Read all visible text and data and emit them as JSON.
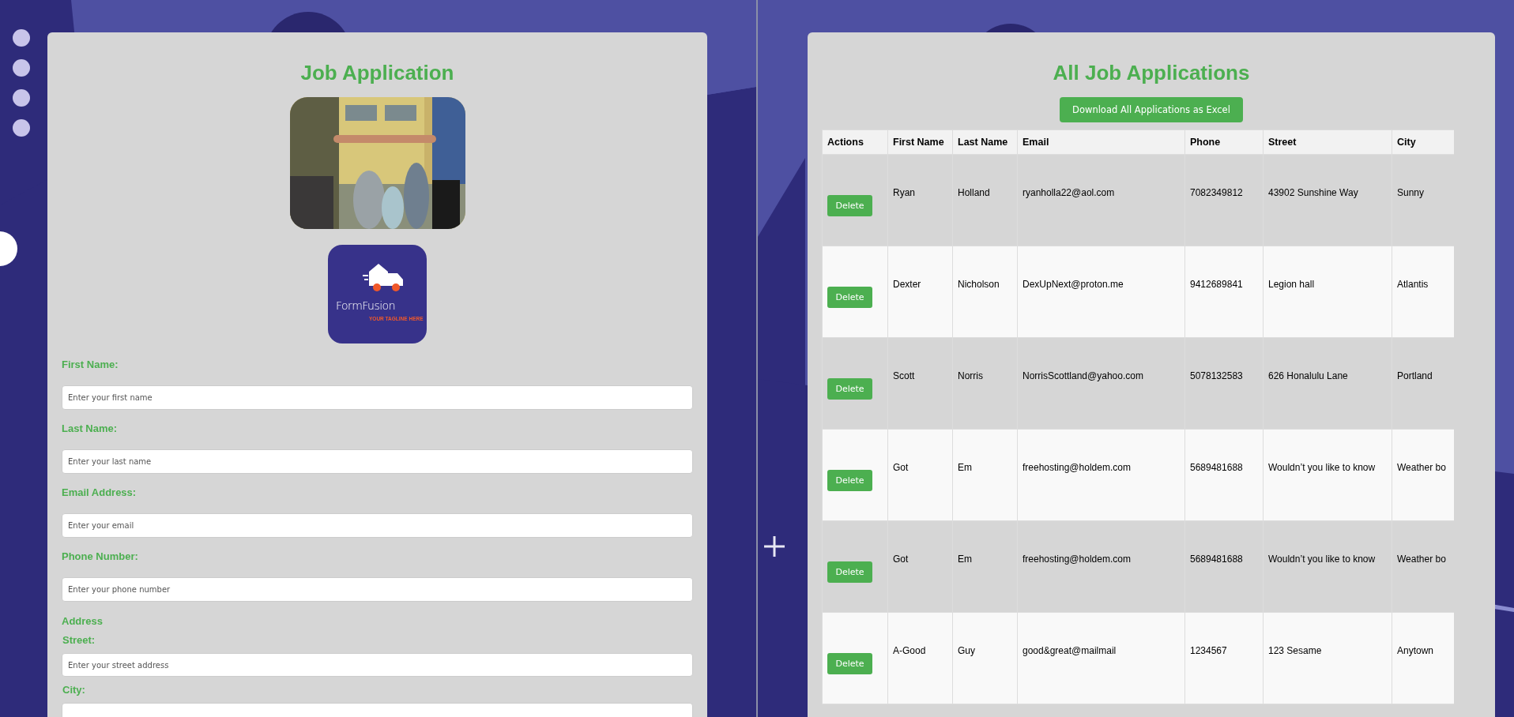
{
  "left_page": {
    "title": "Job Application",
    "logo": {
      "name": "FormFusion",
      "tagline": "YOUR TAGLINE HERE"
    },
    "fields": [
      {
        "label": "First Name:",
        "placeholder": "Enter your first name"
      },
      {
        "label": "Last Name:",
        "placeholder": "Enter your last name"
      },
      {
        "label": "Email Address:",
        "placeholder": "Enter your email"
      },
      {
        "label": "Phone Number:",
        "placeholder": "Enter your phone number"
      }
    ],
    "address": {
      "heading": "Address",
      "fields": [
        {
          "label": "Street:",
          "placeholder": "Enter your street address"
        },
        {
          "label": "City:"
        }
      ]
    }
  },
  "right_page": {
    "title": "All Job Applications",
    "download_button": "Download All Applications as Excel",
    "columns": [
      "Actions",
      "First Name",
      "Last Name",
      "Email",
      "Phone",
      "Street",
      "City"
    ],
    "rows": [
      {
        "cells": [
          "Delete",
          "Ryan",
          "Holland",
          "ryanholla22@aol.com",
          "7082349812",
          "43902 Sunshine Way",
          "Sunny"
        ]
      },
      {
        "cells": [
          "Delete",
          "Dexter",
          "Nicholson",
          "DexUpNext@proton.me",
          "9412689841",
          "Legion hall",
          "Atlantis"
        ]
      },
      {
        "cells": [
          "Delete",
          "Scott",
          "Norris",
          "NorrisScottland@yahoo.com",
          "5078132583",
          "626 Honalulu Lane",
          "Portland"
        ]
      },
      {
        "cells": [
          "Delete",
          "Got",
          "Em",
          "freehosting@holdem.com",
          "5689481688",
          "Wouldn’t you like to know",
          "Weather bo"
        ]
      },
      {
        "cells": [
          "Delete",
          "Got",
          "Em",
          "freehosting@holdem.com",
          "5689481688",
          "Wouldn’t you like to know",
          "Weather bo"
        ]
      },
      {
        "cells": [
          "Delete",
          "A-Good",
          "Guy",
          "good&great@mailmail",
          "1234567",
          "123 Sesame",
          "Anytown"
        ]
      }
    ]
  }
}
